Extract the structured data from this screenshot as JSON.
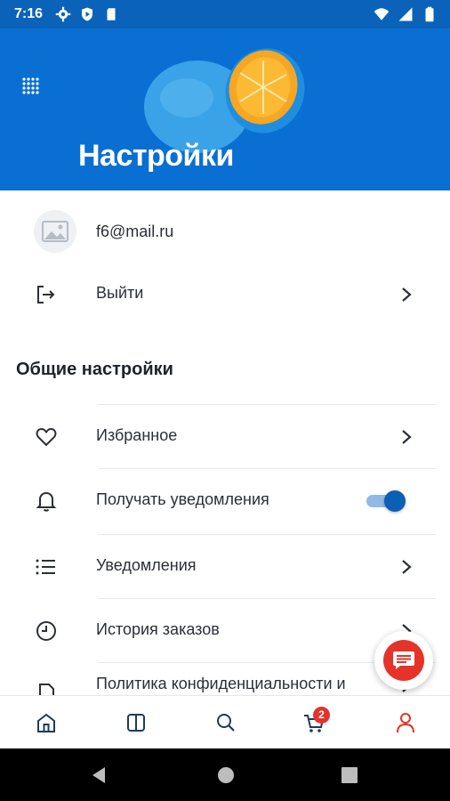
{
  "status_bar": {
    "time": "7:16",
    "icons_left": [
      "settings-icon",
      "shield-icon",
      "sd-card-icon"
    ],
    "icons_right": [
      "wifi-icon",
      "signal-icon",
      "battery-icon"
    ]
  },
  "header": {
    "title": "Настройки",
    "menu_icon": "grid-dots-icon"
  },
  "account": {
    "email": "f6@mail.ru",
    "logout_label": "Выйти"
  },
  "general_settings": {
    "title": "Общие настройки",
    "items": [
      {
        "label": "Избранное",
        "icon": "heart-icon",
        "control": "chevron"
      },
      {
        "label": "Получать уведомления",
        "icon": "bell-icon",
        "control": "toggle",
        "enabled": true
      },
      {
        "label": "Уведомления",
        "icon": "list-icon",
        "control": "chevron"
      },
      {
        "label": "История заказов",
        "icon": "clock-icon",
        "control": "chevron"
      },
      {
        "label": "Политика конфиденциальности и",
        "icon": "document-icon",
        "control": "chevron"
      }
    ]
  },
  "fab": {
    "icon": "chat-icon"
  },
  "bottom_nav": {
    "items": [
      {
        "name": "home",
        "icon": "home-icon"
      },
      {
        "name": "catalog",
        "icon": "catalog-icon"
      },
      {
        "name": "search",
        "icon": "search-icon"
      },
      {
        "name": "cart",
        "icon": "cart-icon",
        "badge": "2"
      },
      {
        "name": "profile",
        "icon": "user-icon",
        "active": true
      }
    ]
  },
  "colors": {
    "accent": "#0b5fb4",
    "header_bg": "#0a6fd3",
    "active_nav": "#e5332a",
    "badge": "#e5332a"
  }
}
